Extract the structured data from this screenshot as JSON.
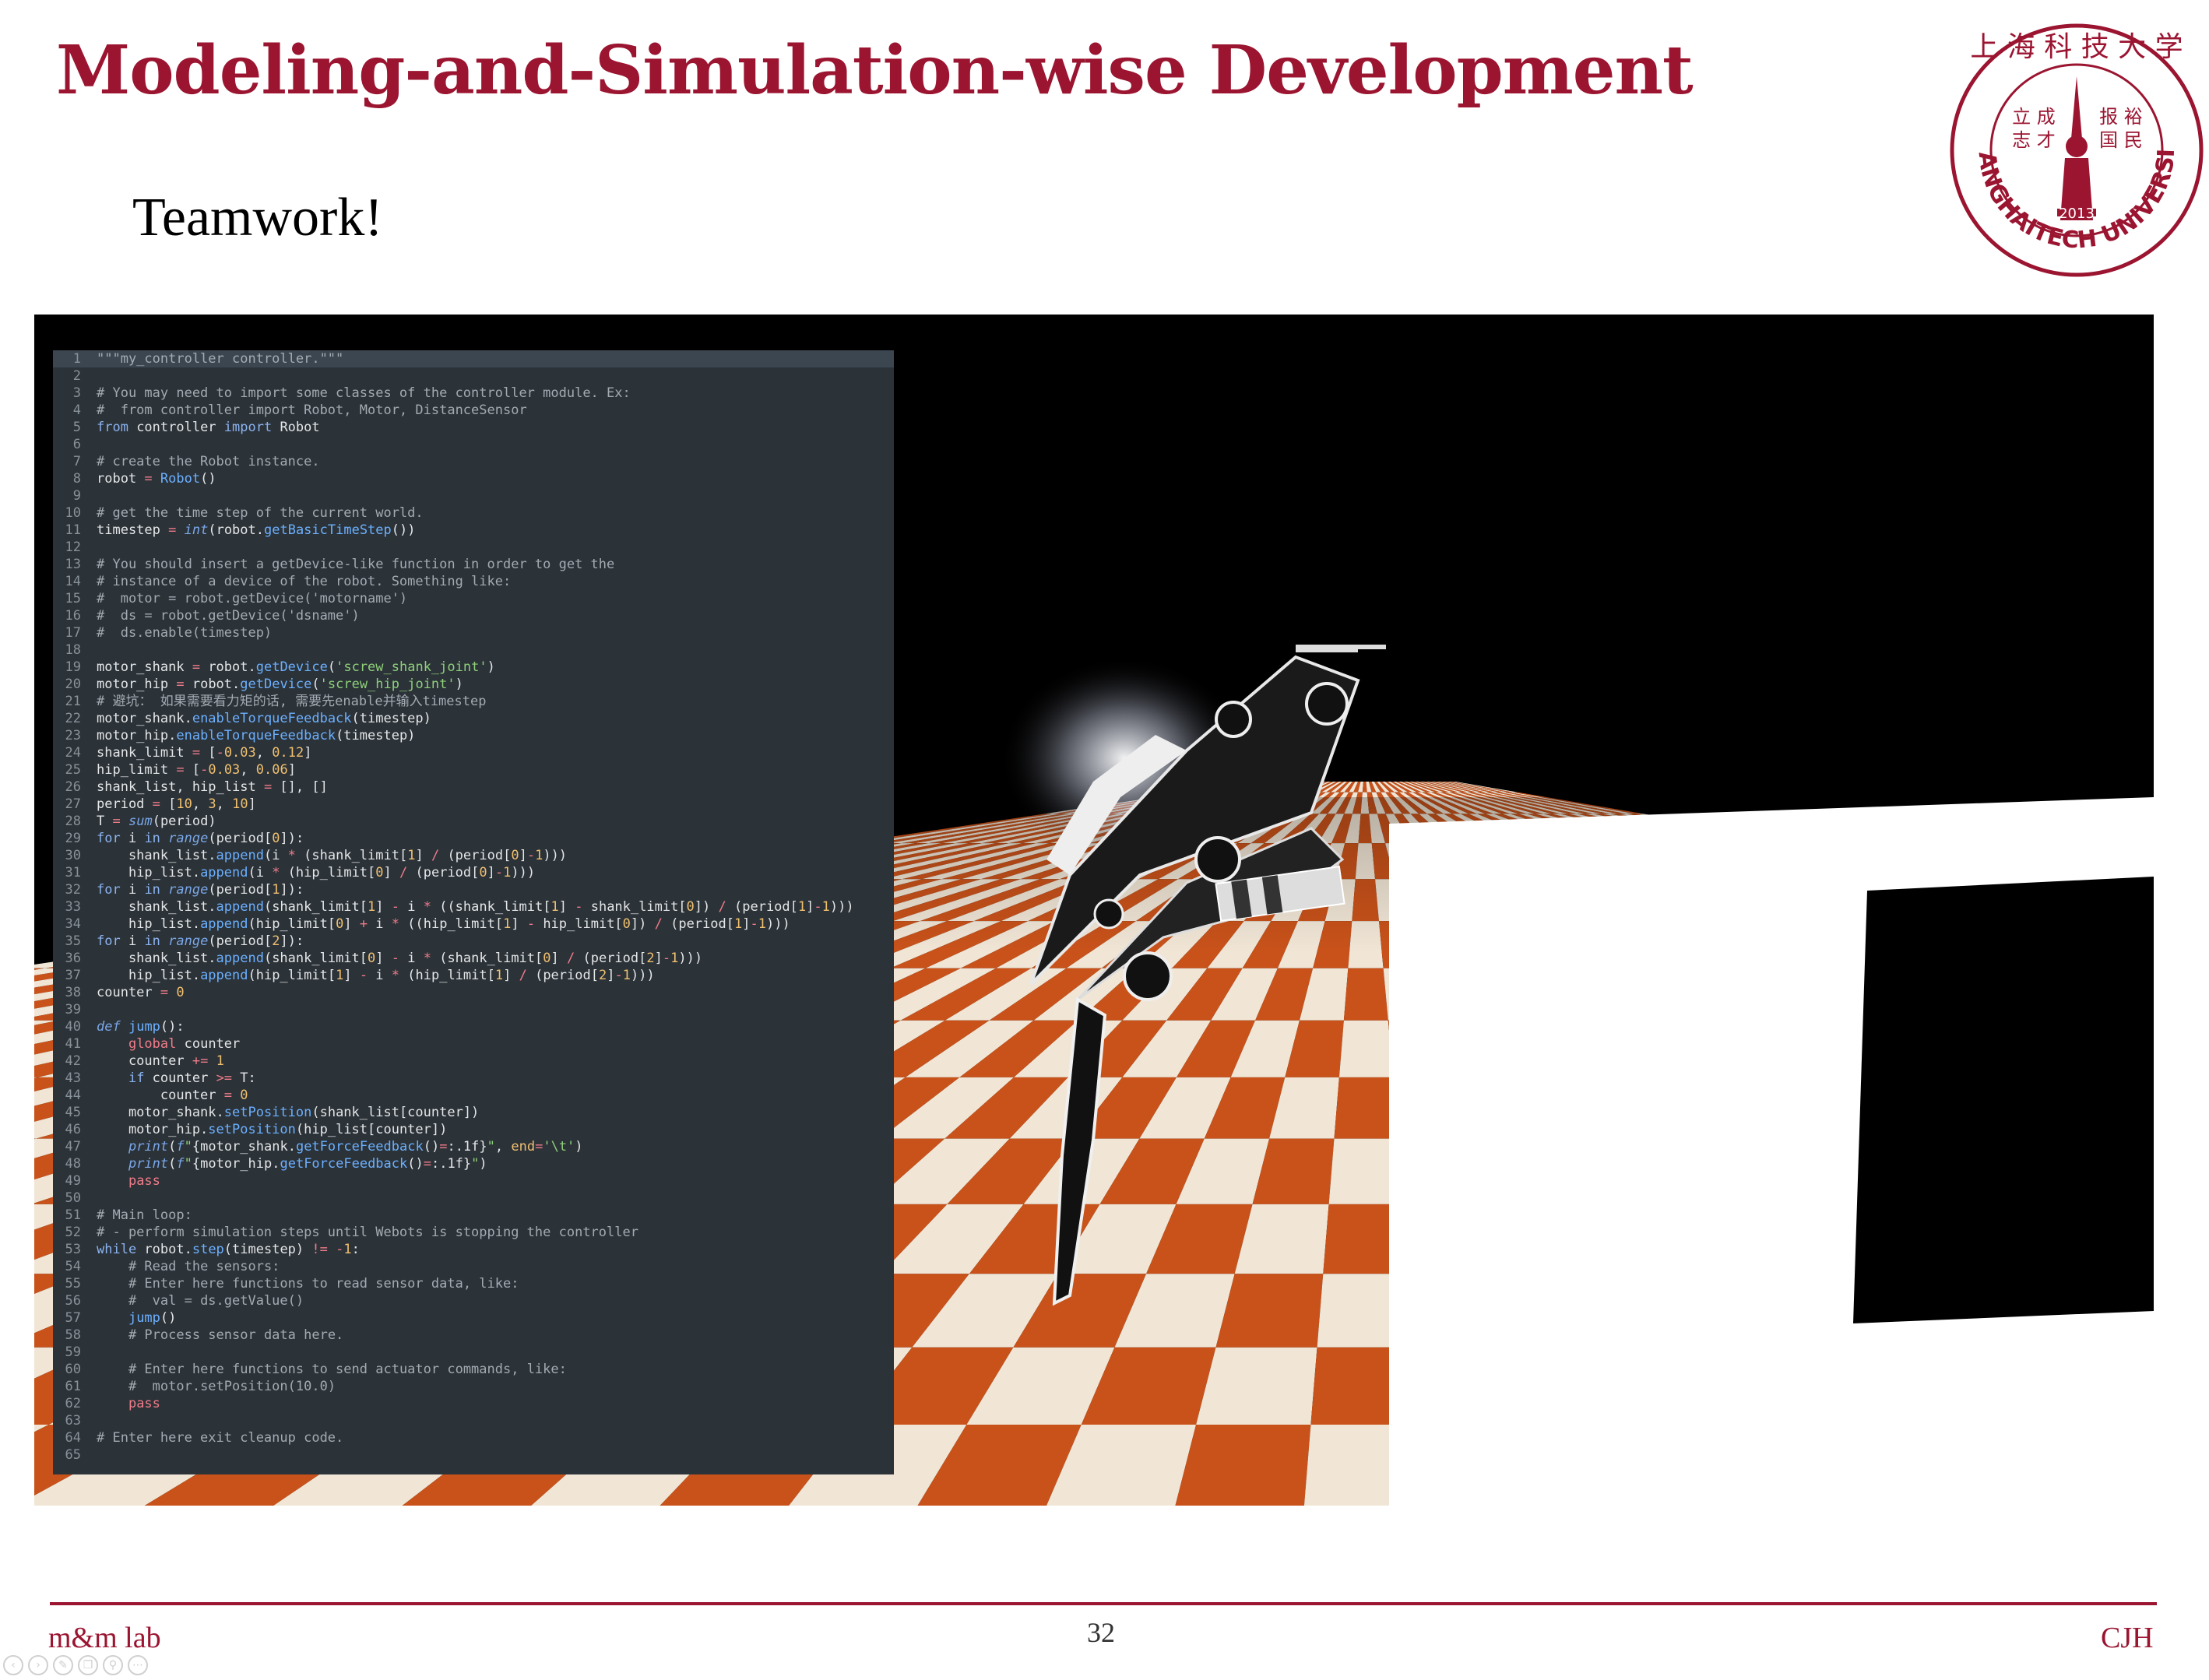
{
  "slide": {
    "title": "Modeling-and-Simulation-wise Development",
    "subtitle": "Teamwork!",
    "page_number": "32",
    "footer_left": "m&m lab",
    "footer_right": "CJH"
  },
  "logo": {
    "top_text": "上海科技大学",
    "motto_left": "立成志才",
    "motto_right": "报裕国民",
    "year": "2013",
    "ring_text": "SHANGHAITECH UNIVERSITY",
    "color": "#9b1531"
  },
  "code_editor": {
    "active_line": 1,
    "lines": [
      [
        [
          "cm",
          "\"\"\"my_controller controller.\"\"\""
        ]
      ],
      [],
      [
        [
          "cm",
          "# You may need to import some classes of the controller module. Ex:"
        ]
      ],
      [
        [
          "cm",
          "#  from controller import Robot, Motor, DistanceSensor"
        ]
      ],
      [
        [
          "kw",
          "from"
        ],
        [
          "tx",
          " controller "
        ],
        [
          "kw",
          "import"
        ],
        [
          "tx",
          " Robot"
        ]
      ],
      [],
      [
        [
          "cm",
          "# create the Robot instance."
        ]
      ],
      [
        [
          "tx",
          "robot "
        ],
        [
          "op",
          "="
        ],
        [
          "tx",
          " "
        ],
        [
          "fn",
          "Robot"
        ],
        [
          "tx",
          "()"
        ]
      ],
      [],
      [
        [
          "cm",
          "# get the time step of the current world."
        ]
      ],
      [
        [
          "tx",
          "timestep "
        ],
        [
          "op",
          "="
        ],
        [
          "tx",
          " "
        ],
        [
          "bi",
          "int"
        ],
        [
          "tx",
          "(robot."
        ],
        [
          "fn",
          "getBasicTimeStep"
        ],
        [
          "tx",
          "())"
        ]
      ],
      [],
      [
        [
          "cm",
          "# You should insert a getDevice-like function in order to get the"
        ]
      ],
      [
        [
          "cm",
          "# instance of a device of the robot. Something like:"
        ]
      ],
      [
        [
          "cm",
          "#  motor = robot.getDevice('motorname')"
        ]
      ],
      [
        [
          "cm",
          "#  ds = robot.getDevice('dsname')"
        ]
      ],
      [
        [
          "cm",
          "#  ds.enable(timestep)"
        ]
      ],
      [],
      [
        [
          "tx",
          "motor_shank "
        ],
        [
          "op",
          "="
        ],
        [
          "tx",
          " robot."
        ],
        [
          "fn",
          "getDevice"
        ],
        [
          "tx",
          "("
        ],
        [
          "st",
          "'screw_shank_joint'"
        ],
        [
          "tx",
          ")"
        ]
      ],
      [
        [
          "tx",
          "motor_hip "
        ],
        [
          "op",
          "="
        ],
        [
          "tx",
          " robot."
        ],
        [
          "fn",
          "getDevice"
        ],
        [
          "tx",
          "("
        ],
        [
          "st",
          "'screw_hip_joint'"
        ],
        [
          "tx",
          ")"
        ]
      ],
      [
        [
          "cm",
          "# 避坑： 如果需要看力矩的话, 需要先enable并输入timestep"
        ]
      ],
      [
        [
          "tx",
          "motor_shank."
        ],
        [
          "fn",
          "enableTorqueFeedback"
        ],
        [
          "tx",
          "(timestep)"
        ]
      ],
      [
        [
          "tx",
          "motor_hip."
        ],
        [
          "fn",
          "enableTorqueFeedback"
        ],
        [
          "tx",
          "(timestep)"
        ]
      ],
      [
        [
          "tx",
          "shank_limit "
        ],
        [
          "op",
          "="
        ],
        [
          "tx",
          " ["
        ],
        [
          "op",
          "-"
        ],
        [
          "nm",
          "0.03"
        ],
        [
          "tx",
          ", "
        ],
        [
          "nm",
          "0.12"
        ],
        [
          "tx",
          "]"
        ]
      ],
      [
        [
          "tx",
          "hip_limit "
        ],
        [
          "op",
          "="
        ],
        [
          "tx",
          " ["
        ],
        [
          "op",
          "-"
        ],
        [
          "nm",
          "0.03"
        ],
        [
          "tx",
          ", "
        ],
        [
          "nm",
          "0.06"
        ],
        [
          "tx",
          "]"
        ]
      ],
      [
        [
          "tx",
          "shank_list, hip_list "
        ],
        [
          "op",
          "="
        ],
        [
          "tx",
          " [], []"
        ]
      ],
      [
        [
          "tx",
          "period "
        ],
        [
          "op",
          "="
        ],
        [
          "tx",
          " ["
        ],
        [
          "nm",
          "10"
        ],
        [
          "tx",
          ", "
        ],
        [
          "nm",
          "3"
        ],
        [
          "tx",
          ", "
        ],
        [
          "nm",
          "10"
        ],
        [
          "tx",
          "]"
        ]
      ],
      [
        [
          "tx",
          "T "
        ],
        [
          "op",
          "="
        ],
        [
          "tx",
          " "
        ],
        [
          "bi",
          "sum"
        ],
        [
          "tx",
          "(period)"
        ]
      ],
      [
        [
          "kw",
          "for"
        ],
        [
          "tx",
          " i "
        ],
        [
          "kw",
          "in"
        ],
        [
          "tx",
          " "
        ],
        [
          "bi",
          "range"
        ],
        [
          "tx",
          "(period["
        ],
        [
          "nm",
          "0"
        ],
        [
          "tx",
          "]):"
        ]
      ],
      [
        [
          "tx",
          "    shank_list."
        ],
        [
          "fn",
          "append"
        ],
        [
          "tx",
          "(i "
        ],
        [
          "op",
          "*"
        ],
        [
          "tx",
          " (shank_limit["
        ],
        [
          "nm",
          "1"
        ],
        [
          "tx",
          "] "
        ],
        [
          "op",
          "/"
        ],
        [
          "tx",
          " (period["
        ],
        [
          "nm",
          "0"
        ],
        [
          "tx",
          "]"
        ],
        [
          "op",
          "-"
        ],
        [
          "nm",
          "1"
        ],
        [
          "tx",
          ")))"
        ]
      ],
      [
        [
          "tx",
          "    hip_list."
        ],
        [
          "fn",
          "append"
        ],
        [
          "tx",
          "(i "
        ],
        [
          "op",
          "*"
        ],
        [
          "tx",
          " (hip_limit["
        ],
        [
          "nm",
          "0"
        ],
        [
          "tx",
          "] "
        ],
        [
          "op",
          "/"
        ],
        [
          "tx",
          " (period["
        ],
        [
          "nm",
          "0"
        ],
        [
          "tx",
          "]"
        ],
        [
          "op",
          "-"
        ],
        [
          "nm",
          "1"
        ],
        [
          "tx",
          ")))"
        ]
      ],
      [
        [
          "kw",
          "for"
        ],
        [
          "tx",
          " i "
        ],
        [
          "kw",
          "in"
        ],
        [
          "tx",
          " "
        ],
        [
          "bi",
          "range"
        ],
        [
          "tx",
          "(period["
        ],
        [
          "nm",
          "1"
        ],
        [
          "tx",
          "]):"
        ]
      ],
      [
        [
          "tx",
          "    shank_list."
        ],
        [
          "fn",
          "append"
        ],
        [
          "tx",
          "(shank_limit["
        ],
        [
          "nm",
          "1"
        ],
        [
          "tx",
          "] "
        ],
        [
          "op",
          "-"
        ],
        [
          "tx",
          " i "
        ],
        [
          "op",
          "*"
        ],
        [
          "tx",
          " ((shank_limit["
        ],
        [
          "nm",
          "1"
        ],
        [
          "tx",
          "] "
        ],
        [
          "op",
          "-"
        ],
        [
          "tx",
          " shank_limit["
        ],
        [
          "nm",
          "0"
        ],
        [
          "tx",
          "]) "
        ],
        [
          "op",
          "/"
        ],
        [
          "tx",
          " (period["
        ],
        [
          "nm",
          "1"
        ],
        [
          "tx",
          "]"
        ],
        [
          "op",
          "-"
        ],
        [
          "nm",
          "1"
        ],
        [
          "tx",
          ")))"
        ]
      ],
      [
        [
          "tx",
          "    hip_list."
        ],
        [
          "fn",
          "append"
        ],
        [
          "tx",
          "(hip_limit["
        ],
        [
          "nm",
          "0"
        ],
        [
          "tx",
          "] "
        ],
        [
          "op",
          "+"
        ],
        [
          "tx",
          " i "
        ],
        [
          "op",
          "*"
        ],
        [
          "tx",
          " ((hip_limit["
        ],
        [
          "nm",
          "1"
        ],
        [
          "tx",
          "] "
        ],
        [
          "op",
          "-"
        ],
        [
          "tx",
          " hip_limit["
        ],
        [
          "nm",
          "0"
        ],
        [
          "tx",
          "]) "
        ],
        [
          "op",
          "/"
        ],
        [
          "tx",
          " (period["
        ],
        [
          "nm",
          "1"
        ],
        [
          "tx",
          "]"
        ],
        [
          "op",
          "-"
        ],
        [
          "nm",
          "1"
        ],
        [
          "tx",
          ")))"
        ]
      ],
      [
        [
          "kw",
          "for"
        ],
        [
          "tx",
          " i "
        ],
        [
          "kw",
          "in"
        ],
        [
          "tx",
          " "
        ],
        [
          "bi",
          "range"
        ],
        [
          "tx",
          "(period["
        ],
        [
          "nm",
          "2"
        ],
        [
          "tx",
          "]):"
        ]
      ],
      [
        [
          "tx",
          "    shank_list."
        ],
        [
          "fn",
          "append"
        ],
        [
          "tx",
          "(shank_limit["
        ],
        [
          "nm",
          "0"
        ],
        [
          "tx",
          "] "
        ],
        [
          "op",
          "-"
        ],
        [
          "tx",
          " i "
        ],
        [
          "op",
          "*"
        ],
        [
          "tx",
          " (shank_limit["
        ],
        [
          "nm",
          "0"
        ],
        [
          "tx",
          "] "
        ],
        [
          "op",
          "/"
        ],
        [
          "tx",
          " (period["
        ],
        [
          "nm",
          "2"
        ],
        [
          "tx",
          "]"
        ],
        [
          "op",
          "-"
        ],
        [
          "nm",
          "1"
        ],
        [
          "tx",
          ")))"
        ]
      ],
      [
        [
          "tx",
          "    hip_list."
        ],
        [
          "fn",
          "append"
        ],
        [
          "tx",
          "(hip_limit["
        ],
        [
          "nm",
          "1"
        ],
        [
          "tx",
          "] "
        ],
        [
          "op",
          "-"
        ],
        [
          "tx",
          " i "
        ],
        [
          "op",
          "*"
        ],
        [
          "tx",
          " (hip_limit["
        ],
        [
          "nm",
          "1"
        ],
        [
          "tx",
          "] "
        ],
        [
          "op",
          "/"
        ],
        [
          "tx",
          " (period["
        ],
        [
          "nm",
          "2"
        ],
        [
          "tx",
          "]"
        ],
        [
          "op",
          "-"
        ],
        [
          "nm",
          "1"
        ],
        [
          "tx",
          ")))"
        ]
      ],
      [
        [
          "tx",
          "counter "
        ],
        [
          "op",
          "="
        ],
        [
          "tx",
          " "
        ],
        [
          "nm",
          "0"
        ]
      ],
      [],
      [
        [
          "bi",
          "def"
        ],
        [
          "tx",
          " "
        ],
        [
          "fn",
          "jump"
        ],
        [
          "tx",
          "():"
        ]
      ],
      [
        [
          "tx",
          "    "
        ],
        [
          "gl",
          "global"
        ],
        [
          "tx",
          " counter"
        ]
      ],
      [
        [
          "tx",
          "    counter "
        ],
        [
          "op",
          "+="
        ],
        [
          "tx",
          " "
        ],
        [
          "nm",
          "1"
        ]
      ],
      [
        [
          "tx",
          "    "
        ],
        [
          "kw",
          "if"
        ],
        [
          "tx",
          " counter "
        ],
        [
          "op",
          ">="
        ],
        [
          "tx",
          " T:"
        ]
      ],
      [
        [
          "tx",
          "        counter "
        ],
        [
          "op",
          "="
        ],
        [
          "tx",
          " "
        ],
        [
          "nm",
          "0"
        ]
      ],
      [
        [
          "tx",
          "    motor_shank."
        ],
        [
          "fn",
          "setPosition"
        ],
        [
          "tx",
          "(shank_list[counter])"
        ]
      ],
      [
        [
          "tx",
          "    motor_hip."
        ],
        [
          "fn",
          "setPosition"
        ],
        [
          "tx",
          "(hip_list[counter])"
        ]
      ],
      [
        [
          "tx",
          "    "
        ],
        [
          "bi",
          "print"
        ],
        [
          "tx",
          "("
        ],
        [
          "bi",
          "f"
        ],
        [
          "st",
          "\""
        ],
        [
          "tx",
          "{motor_shank."
        ],
        [
          "fn",
          "getForceFeedback"
        ],
        [
          "tx",
          "()"
        ],
        [
          "op",
          "="
        ],
        [
          "tx",
          ":.1f}"
        ],
        [
          "st",
          "\""
        ],
        [
          "tx",
          ", "
        ],
        [
          "nm",
          "end"
        ],
        [
          "op",
          "="
        ],
        [
          "st",
          "'\\t'"
        ],
        [
          "tx",
          ")"
        ]
      ],
      [
        [
          "tx",
          "    "
        ],
        [
          "bi",
          "print"
        ],
        [
          "tx",
          "("
        ],
        [
          "bi",
          "f"
        ],
        [
          "st",
          "\""
        ],
        [
          "tx",
          "{motor_hip."
        ],
        [
          "fn",
          "getForceFeedback"
        ],
        [
          "tx",
          "()"
        ],
        [
          "op",
          "="
        ],
        [
          "tx",
          ":.1f}"
        ],
        [
          "st",
          "\""
        ],
        [
          "tx",
          ")"
        ]
      ],
      [
        [
          "tx",
          "    "
        ],
        [
          "gl",
          "pass"
        ]
      ],
      [],
      [
        [
          "cm",
          "# Main loop:"
        ]
      ],
      [
        [
          "cm",
          "# - perform simulation steps until Webots is stopping the controller"
        ]
      ],
      [
        [
          "kw",
          "while"
        ],
        [
          "tx",
          " robot."
        ],
        [
          "fn",
          "step"
        ],
        [
          "tx",
          "(timestep) "
        ],
        [
          "op",
          "!="
        ],
        [
          "tx",
          " "
        ],
        [
          "op",
          "-"
        ],
        [
          "nm",
          "1"
        ],
        [
          "tx",
          ":"
        ]
      ],
      [
        [
          "tx",
          "    "
        ],
        [
          "cm",
          "# Read the sensors:"
        ]
      ],
      [
        [
          "tx",
          "    "
        ],
        [
          "cm",
          "# Enter here functions to read sensor data, like:"
        ]
      ],
      [
        [
          "tx",
          "    "
        ],
        [
          "cm",
          "#  val = ds.getValue()"
        ]
      ],
      [
        [
          "tx",
          "    "
        ],
        [
          "fn",
          "jump"
        ],
        [
          "tx",
          "()"
        ]
      ],
      [
        [
          "tx",
          "    "
        ],
        [
          "cm",
          "# Process sensor data here."
        ]
      ],
      [],
      [
        [
          "tx",
          "    "
        ],
        [
          "cm",
          "# Enter here functions to send actuator commands, like:"
        ]
      ],
      [
        [
          "tx",
          "    "
        ],
        [
          "cm",
          "#  motor.setPosition(10.0)"
        ]
      ],
      [
        [
          "tx",
          "    "
        ],
        [
          "gl",
          "pass"
        ]
      ],
      [],
      [
        [
          "cm",
          "# Enter here exit cleanup code."
        ]
      ],
      []
    ]
  },
  "presentation_controls": [
    "prev-icon",
    "next-icon",
    "pen-icon",
    "copy-icon",
    "zoom-icon",
    "more-icon"
  ]
}
